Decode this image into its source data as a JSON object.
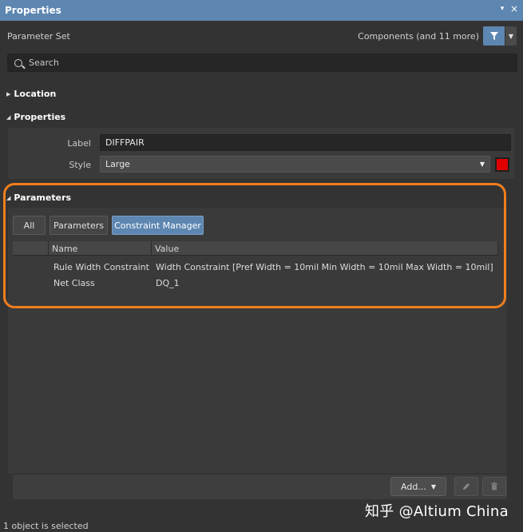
{
  "window": {
    "title": "Properties",
    "pin_icon": "▾",
    "close_icon": "×"
  },
  "parameter_set": {
    "label": "Parameter Set",
    "filter_text": "Components (and 11 more)"
  },
  "search": {
    "placeholder": "Search"
  },
  "sections": {
    "location": "Location",
    "properties": "Properties",
    "parameters": "Parameters"
  },
  "properties": {
    "label_caption": "Label",
    "label_value": "DIFFPAIR",
    "style_caption": "Style",
    "style_value": "Large",
    "style_color": "#e00000"
  },
  "parameter_tabs": [
    {
      "label": "All",
      "active": false
    },
    {
      "label": "Parameters",
      "active": false
    },
    {
      "label": "Constraint Manager",
      "active": true
    }
  ],
  "table": {
    "columns": [
      "Name",
      "Value"
    ],
    "rows": [
      {
        "name": "Rule Width Constraint",
        "value": "Width Constraint [Pref Width = 10mil   Min Width = 10mil   Max Width = 10mil]"
      },
      {
        "name": "Net Class",
        "value": "DQ_1"
      }
    ]
  },
  "actions": {
    "add_label": "Add...",
    "add_arrow": "▼"
  },
  "status": {
    "text": "1 object is selected"
  },
  "watermark": {
    "text": "知乎 @Altium China"
  },
  "colors": {
    "accent": "#5d86b1",
    "highlight": "#f07e1e",
    "background": "#333333"
  }
}
